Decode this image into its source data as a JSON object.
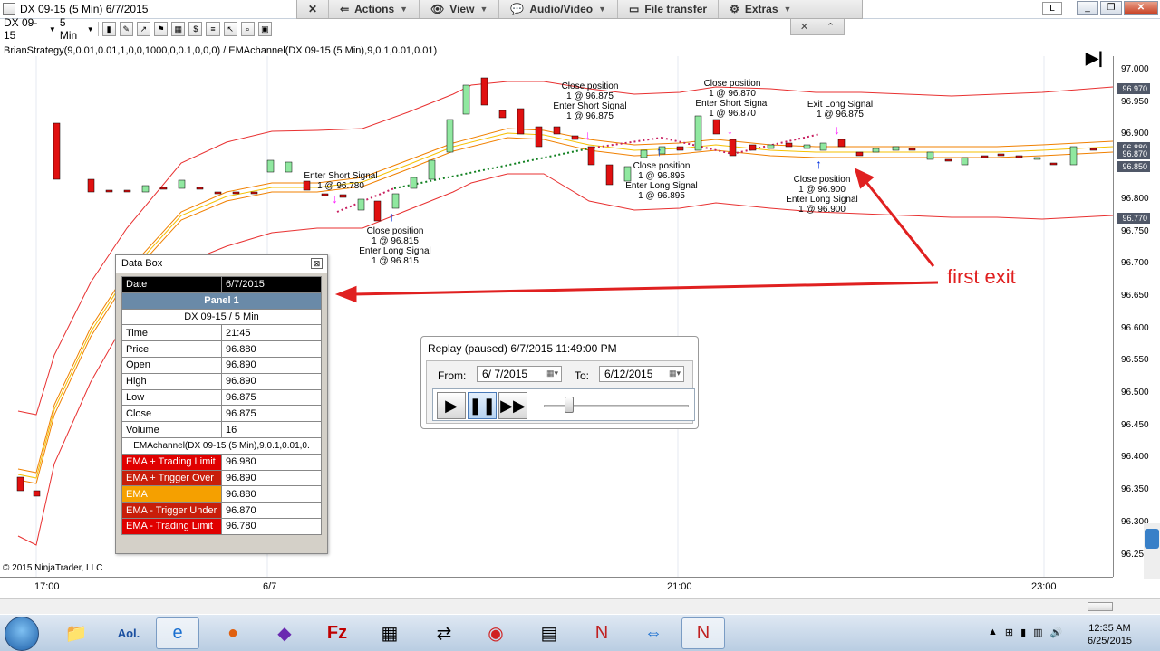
{
  "window": {
    "title": "DX 09-15 (5 Min)  6/7/2015",
    "l_button": "L"
  },
  "remote_menu": {
    "items": [
      {
        "label": "",
        "icon": "close-icon"
      },
      {
        "label": "Actions",
        "icon": "actions-icon"
      },
      {
        "label": "View",
        "icon": "eye-icon"
      },
      {
        "label": "Audio/Video",
        "icon": "chat-icon"
      },
      {
        "label": "File transfer",
        "icon": "file-icon"
      },
      {
        "label": "Extras",
        "icon": "extras-icon"
      }
    ]
  },
  "toolbar": {
    "instrument": "DX 09-15",
    "interval": "5 Min"
  },
  "indicator_line": "BrianStrategy(9,0.01,0.01,1,0,0,1000,0,0.1,0,0,0) / EMAchannel(DX 09-15 (5 Min),9,0.1,0.01,0.01)",
  "copyright": "© 2015 NinjaTrader, LLC",
  "price_axis": {
    "ticks": [
      "97.000",
      "96.950",
      "96.900",
      "96.850",
      "96.800",
      "96.750",
      "96.700",
      "96.650",
      "96.600",
      "96.550",
      "96.500",
      "96.450",
      "96.400",
      "96.350",
      "96.300",
      "96.250"
    ],
    "tags": [
      {
        "label": "96.970",
        "price": 96.97
      },
      {
        "label": "96.880",
        "price": 96.88
      },
      {
        "label": "96.870",
        "price": 96.87
      },
      {
        "label": "96.850",
        "price": 96.85
      },
      {
        "label": "96.770",
        "price": 96.77
      }
    ]
  },
  "time_axis": {
    "ticks": [
      "17:00",
      "6/7",
      "21:00",
      "23:00"
    ]
  },
  "signal_labels": [
    {
      "lines": [
        "Enter Short Signal",
        "1 @ 96.780"
      ]
    },
    {
      "lines": [
        "Close position",
        "1 @ 96.815",
        "Enter Long Signal",
        "1 @ 96.815"
      ]
    },
    {
      "lines": [
        "Close position",
        "1 @ 96.875",
        "Enter Short Signal",
        "1 @ 96.875"
      ]
    },
    {
      "lines": [
        "Close position",
        "1 @ 96.895",
        "Enter Long Signal",
        "1 @ 96.895"
      ]
    },
    {
      "lines": [
        "Close position",
        "1 @ 96.870",
        "Enter Short Signal",
        "1 @ 96.870"
      ]
    },
    {
      "lines": [
        "Exit Long Signal",
        "1 @ 96.875"
      ]
    },
    {
      "lines": [
        "Close position",
        "1 @ 96.900",
        "Enter Long Signal",
        "1 @ 96.900"
      ]
    }
  ],
  "annotation": "first exit",
  "data_box": {
    "title": "Data Box",
    "date_label": "Date",
    "date_value": "6/7/2015",
    "panel": "Panel 1",
    "instrument": "DX 09-15 / 5 Min",
    "rows": [
      {
        "k": "Time",
        "v": "21:45"
      },
      {
        "k": "Price",
        "v": "96.880"
      },
      {
        "k": "Open",
        "v": "96.890"
      },
      {
        "k": "High",
        "v": "96.890"
      },
      {
        "k": "Low",
        "v": "96.875"
      },
      {
        "k": "Close",
        "v": "96.875"
      },
      {
        "k": "Volume",
        "v": "16"
      }
    ],
    "indicator": "EMAchannel(DX 09-15 (5 Min),9,0.1,0.01,0.",
    "indicator_rows": [
      {
        "k": "EMA + Trading Limit",
        "v": "96.980",
        "color": "#e00000"
      },
      {
        "k": "EMA + Trigger Over",
        "v": "96.890",
        "color": "#c81e0a"
      },
      {
        "k": "EMA",
        "v": "96.880",
        "color": "#f5a000"
      },
      {
        "k": "EMA - Trigger Under",
        "v": "96.870",
        "color": "#c81e0a"
      },
      {
        "k": "EMA - Trading Limit",
        "v": "96.780",
        "color": "#e00000"
      }
    ]
  },
  "replay": {
    "title": "Replay (paused) 6/7/2015 11:49:00 PM",
    "from_label": "From:",
    "from_value": "6/  7/2015",
    "to_label": "To:",
    "to_value": "6/12/2015",
    "progress": 0.15
  },
  "taskbar": {
    "apps": [
      "start-orb",
      "file-explorer",
      "aol",
      "internet-explorer",
      "firefox",
      "visual-studio",
      "filezilla",
      "calculator",
      "network-tool",
      "app-red",
      "dea-document",
      "ninjatrader",
      "teamviewer",
      "ninjatrader-window"
    ],
    "time": "12:35 AM",
    "date": "6/25/2015"
  },
  "colors": {
    "channel_outer": "#e83030",
    "channel_inner": "#f08000",
    "ema": "#f5c000",
    "up_bar": "#90e8a0",
    "down_bar": "#e01010",
    "short_marker": "#ff20ff",
    "long_marker": "#0030e0",
    "arrow": "#e02020"
  }
}
